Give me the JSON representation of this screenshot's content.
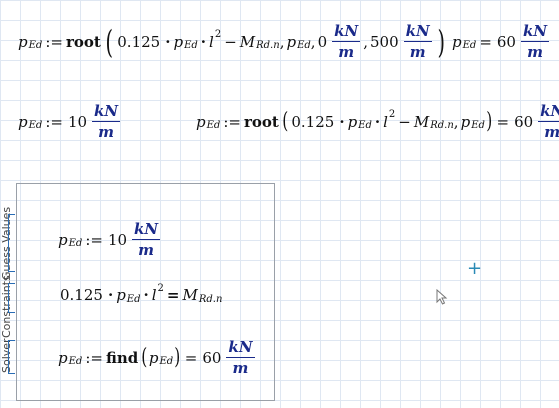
{
  "row1": {
    "lhs_sym": "p",
    "lhs_sub": "Ed",
    "assign": ":=",
    "fn": "root",
    "c1": "0.125",
    "p_sym": "p",
    "p_sub": "Ed",
    "l_sym": "l",
    "l_sup": "2",
    "minus": "−",
    "m_sym": "M",
    "m_sub": "Rd.n",
    "comma1": ",",
    "p2_sym": "p",
    "p2_sub": "Ed",
    "comma2": ",",
    "lo": "0",
    "unit_n": "kN",
    "unit_d": "m",
    "comma3": ",",
    "hi": "500",
    "unit2_n": "kN",
    "unit2_d": "m"
  },
  "row1_result": {
    "sym": "p",
    "sub": "Ed",
    "eq": "=",
    "val": "60",
    "unit_n": "kN",
    "unit_d": "m"
  },
  "row2_guess": {
    "sym": "p",
    "sub": "Ed",
    "assign": ":=",
    "val": "10",
    "unit_n": "kN",
    "unit_d": "m"
  },
  "row2_root": {
    "sym": "p",
    "sub": "Ed",
    "assign": ":=",
    "fn": "root",
    "c1": "0.125",
    "p_sym": "p",
    "p_sub": "Ed",
    "l_sym": "l",
    "l_sup": "2",
    "minus": "−",
    "m_sym": "M",
    "m_sub": "Rd.n",
    "comma": ",",
    "p2_sym": "p",
    "p2_sub": "Ed",
    "eq": "=",
    "val": "60",
    "unit_n": "kN",
    "unit_d": "m"
  },
  "solve_block": {
    "label_guess": "Guess Values",
    "label_constraints": "Constraints",
    "label_solver": "Solver",
    "guess": {
      "sym": "p",
      "sub": "Ed",
      "assign": ":=",
      "val": "10",
      "unit_n": "kN",
      "unit_d": "m"
    },
    "constraint": {
      "c1": "0.125",
      "p_sym": "p",
      "p_sub": "Ed",
      "l_sym": "l",
      "l_sup": "2",
      "eq": "=",
      "m_sym": "M",
      "m_sub": "Rd.n"
    },
    "solver": {
      "sym": "p",
      "sub": "Ed",
      "assign": ":=",
      "fn": "find",
      "arg_sym": "p",
      "arg_sub": "Ed",
      "eq": "=",
      "val": "60",
      "unit_n": "kN",
      "unit_d": "m"
    }
  },
  "icons": {
    "crosshair": "crosshair-icon",
    "cursor": "arrow-cursor-icon"
  },
  "colors": {
    "unit": "#1a2a8a",
    "grid": "#dfe7f2",
    "bracket": "#2a6db5",
    "crosshair": "#2a8ab5"
  }
}
